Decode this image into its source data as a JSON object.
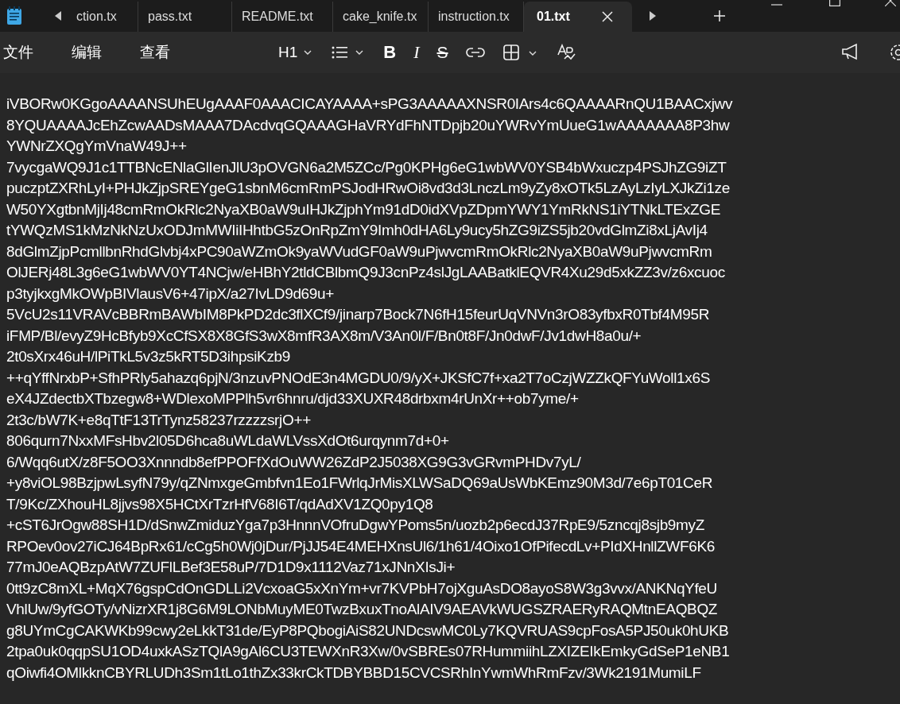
{
  "tabs": [
    {
      "label": "ction.tx",
      "selected": false
    },
    {
      "label": "pass.txt",
      "selected": false
    },
    {
      "label": "README.txt",
      "selected": false
    },
    {
      "label": "cake_knife.tx",
      "selected": false
    },
    {
      "label": "instruction.tx",
      "selected": false
    },
    {
      "label": "01.txt",
      "selected": true
    }
  ],
  "menu": [
    "文件",
    "编辑",
    "查看"
  ],
  "format_buttons": [
    {
      "kind": "heading",
      "label": "H1"
    },
    {
      "kind": "list"
    },
    {
      "kind": "bold",
      "label": "B"
    },
    {
      "kind": "italic",
      "label": "I"
    },
    {
      "kind": "strike",
      "label": "S"
    },
    {
      "kind": "link"
    },
    {
      "kind": "table"
    },
    {
      "kind": "spellcheck"
    }
  ],
  "document": {
    "lines": [
      "iVBORw0KGgoAAAANSUhEUgAAAF0AAACICAYAAAA+sPG3AAAAAXNSR0IArs4c6QAAAARnQU1BAACxjwv",
      "8YQUAAAAJcEhZcwAADsMAAA7DAcdvqGQAAAGHaVRYdFhNTDpjb20uYWRvYmUueG1wAAAAAAA8P3hw",
      "YWNrZXQgYmVnaW49J++",
      "7vycgaWQ9J1c1TTBNcENlaGlIenJlU3pOVGN6a2M5ZCc/Pg0KPHg6eG1wbWV0YSB4bWxuczp4PSJhZG9iZT",
      "puczptZXRhLyI+PHJkZjpSREYgeG1sbnM6cmRmPSJodHRwOi8vd3d3LnczLm9yZy8xOTk5LzAyLzIyLXJkZi1ze",
      "W50YXgtbnMjIj48cmRmOkRlc2NyaXB0aW9uIHJkZjphYm91dD0idXVpZDpmYWY1YmRkNS1iYTNkLTExZGE",
      "tYWQzMS1kMzNkNzUxODJmMWIiIHhtbG5zOnRpZmY9Imh0dHA6Ly9ucy5hZG9iZS5jb20vdGlmZi8xLjAvIj4",
      "8dGlmZjpPcmllbnRhdGlvbj4xPC90aWZmOk9yaWVudGF0aW9uPjwvcmRmOkRlc2NyaXB0aW9uPjwvcmRm",
      "OlJERj48L3g6eG1wbWV0YT4NCjw/eHBhY2tldCBlbmQ9J3cnPz4slJgLAABatklEQVR4Xu29d5xkZZ3v/z6xcuoc",
      "p3tyjkxgMkOWpBIVlausV6+47ipX/a27IvLD9d69u+",
      "5VcU2s11VRAVcBBRmBAWbIM8PkPD2dc3flXCf9/jinarp7Bock7N6fH15feurUqVNVn3rO83yfbxR0Tbf4M95R",
      "iFMP/Bl/evyZ9HcBfyb9XcCfSX8X8GfS3wX8mfR3AX8m/V3An0l/F/Bn0t8F/Jn0dwF/Jv1dwH8a0u/+",
      "2t0sXrx46uH/lPiTkL5v3z5kRT5D3ihpsiKzb9",
      "++qYffNrxbP+SfhPRly5ahazq6pjN/3nzuvPNOdE3n4MGDU0/9/yX+JKSfC7f+xa2T7oCzjWZZkQFYuWoll1x6S",
      "eX4JZdectbXTbzegw8+WDlexoMPPlh5vr6hnru/djd33XUXR48drbxm4rUnXr++ob7yme/+",
      "2t3c/bW7K+e8qTtF13TrTynz58237rzzzzsrjO++",
      "806qurn7NxxMFsHbv2l05D6hca8uWLdaWLVssXdOt6urqynm7d+0+",
      "6/Wqq6utX/z8F5OO3Xnnndb8efPPOFfXdOuWW26ZdP2J5038XG9G3vGRvmPHDv7yL/",
      "+y8viOL98BzjpwLsyfN79y/qZNmxgeGmbfvn1Eo1FWrlqJrMisXLWSaDQ69aUsWbKEmz90M3d/7e6pT01CeR",
      "T/9Kc/ZXhouHL8jjvs98X5HCtXrTzrHfV68I6T/qdAdXV1ZQ0py1Q8",
      "+cST6JrOgw88SH1D/dSnwZmiduzYga7p3HnnnVOfruDgwYPoms5n/uozb2p6ecdJ37RpE9/5zncqj8sjb9myZ",
      "RPOev0ov27iCJ64BpRx61/cCg5h0Wj0jDur/PjJJ54E4MEHXnsUl6/1h61/4Oixo1OfPifecdLv+PIdXHnllZWF6K6",
      "77mJ0eAQBzpAtW7ZUFlLBef3E58uP/7D1D9x1112Vaz71xJNnXIsJi+",
      "0tt9zC8mXL+MqX76gspCdOnGDLLi2VcxoaG5xXnYm+vr7KVPbH7ojXguAsDO8ayoS8W3g3vvx/ANKNqYfeU",
      "VhlUw/9yfGOTy/vNizrXR1j8G6M9LONbMuyME0TwzBxuxTnoAlAIV9AEAVkWUGSZRAERyRAQMtnEAQBQZ",
      "g8UYmCgCAKWKb99cwy2eLkkT31de/EyP8PQbogiAiS82UNDcswMC0Ly7KQVRUAS9cpFosA5PJ50uk0hUKB",
      "2tpa0uk0qqpSU1OD4uxkASzTQlA9gAl6CU3TEWXnR3Xw/0vSBREs07RHummiihLZXIZEIkEmkyGdSeP1eNB1",
      "qOiwfi4OMlkknCBYRLUDh3Sm1tLo1thZx33krCkTDBYBBD15CVCSRhInYwmWhRmFzv/3Wk2191MumiLF"
    ]
  }
}
